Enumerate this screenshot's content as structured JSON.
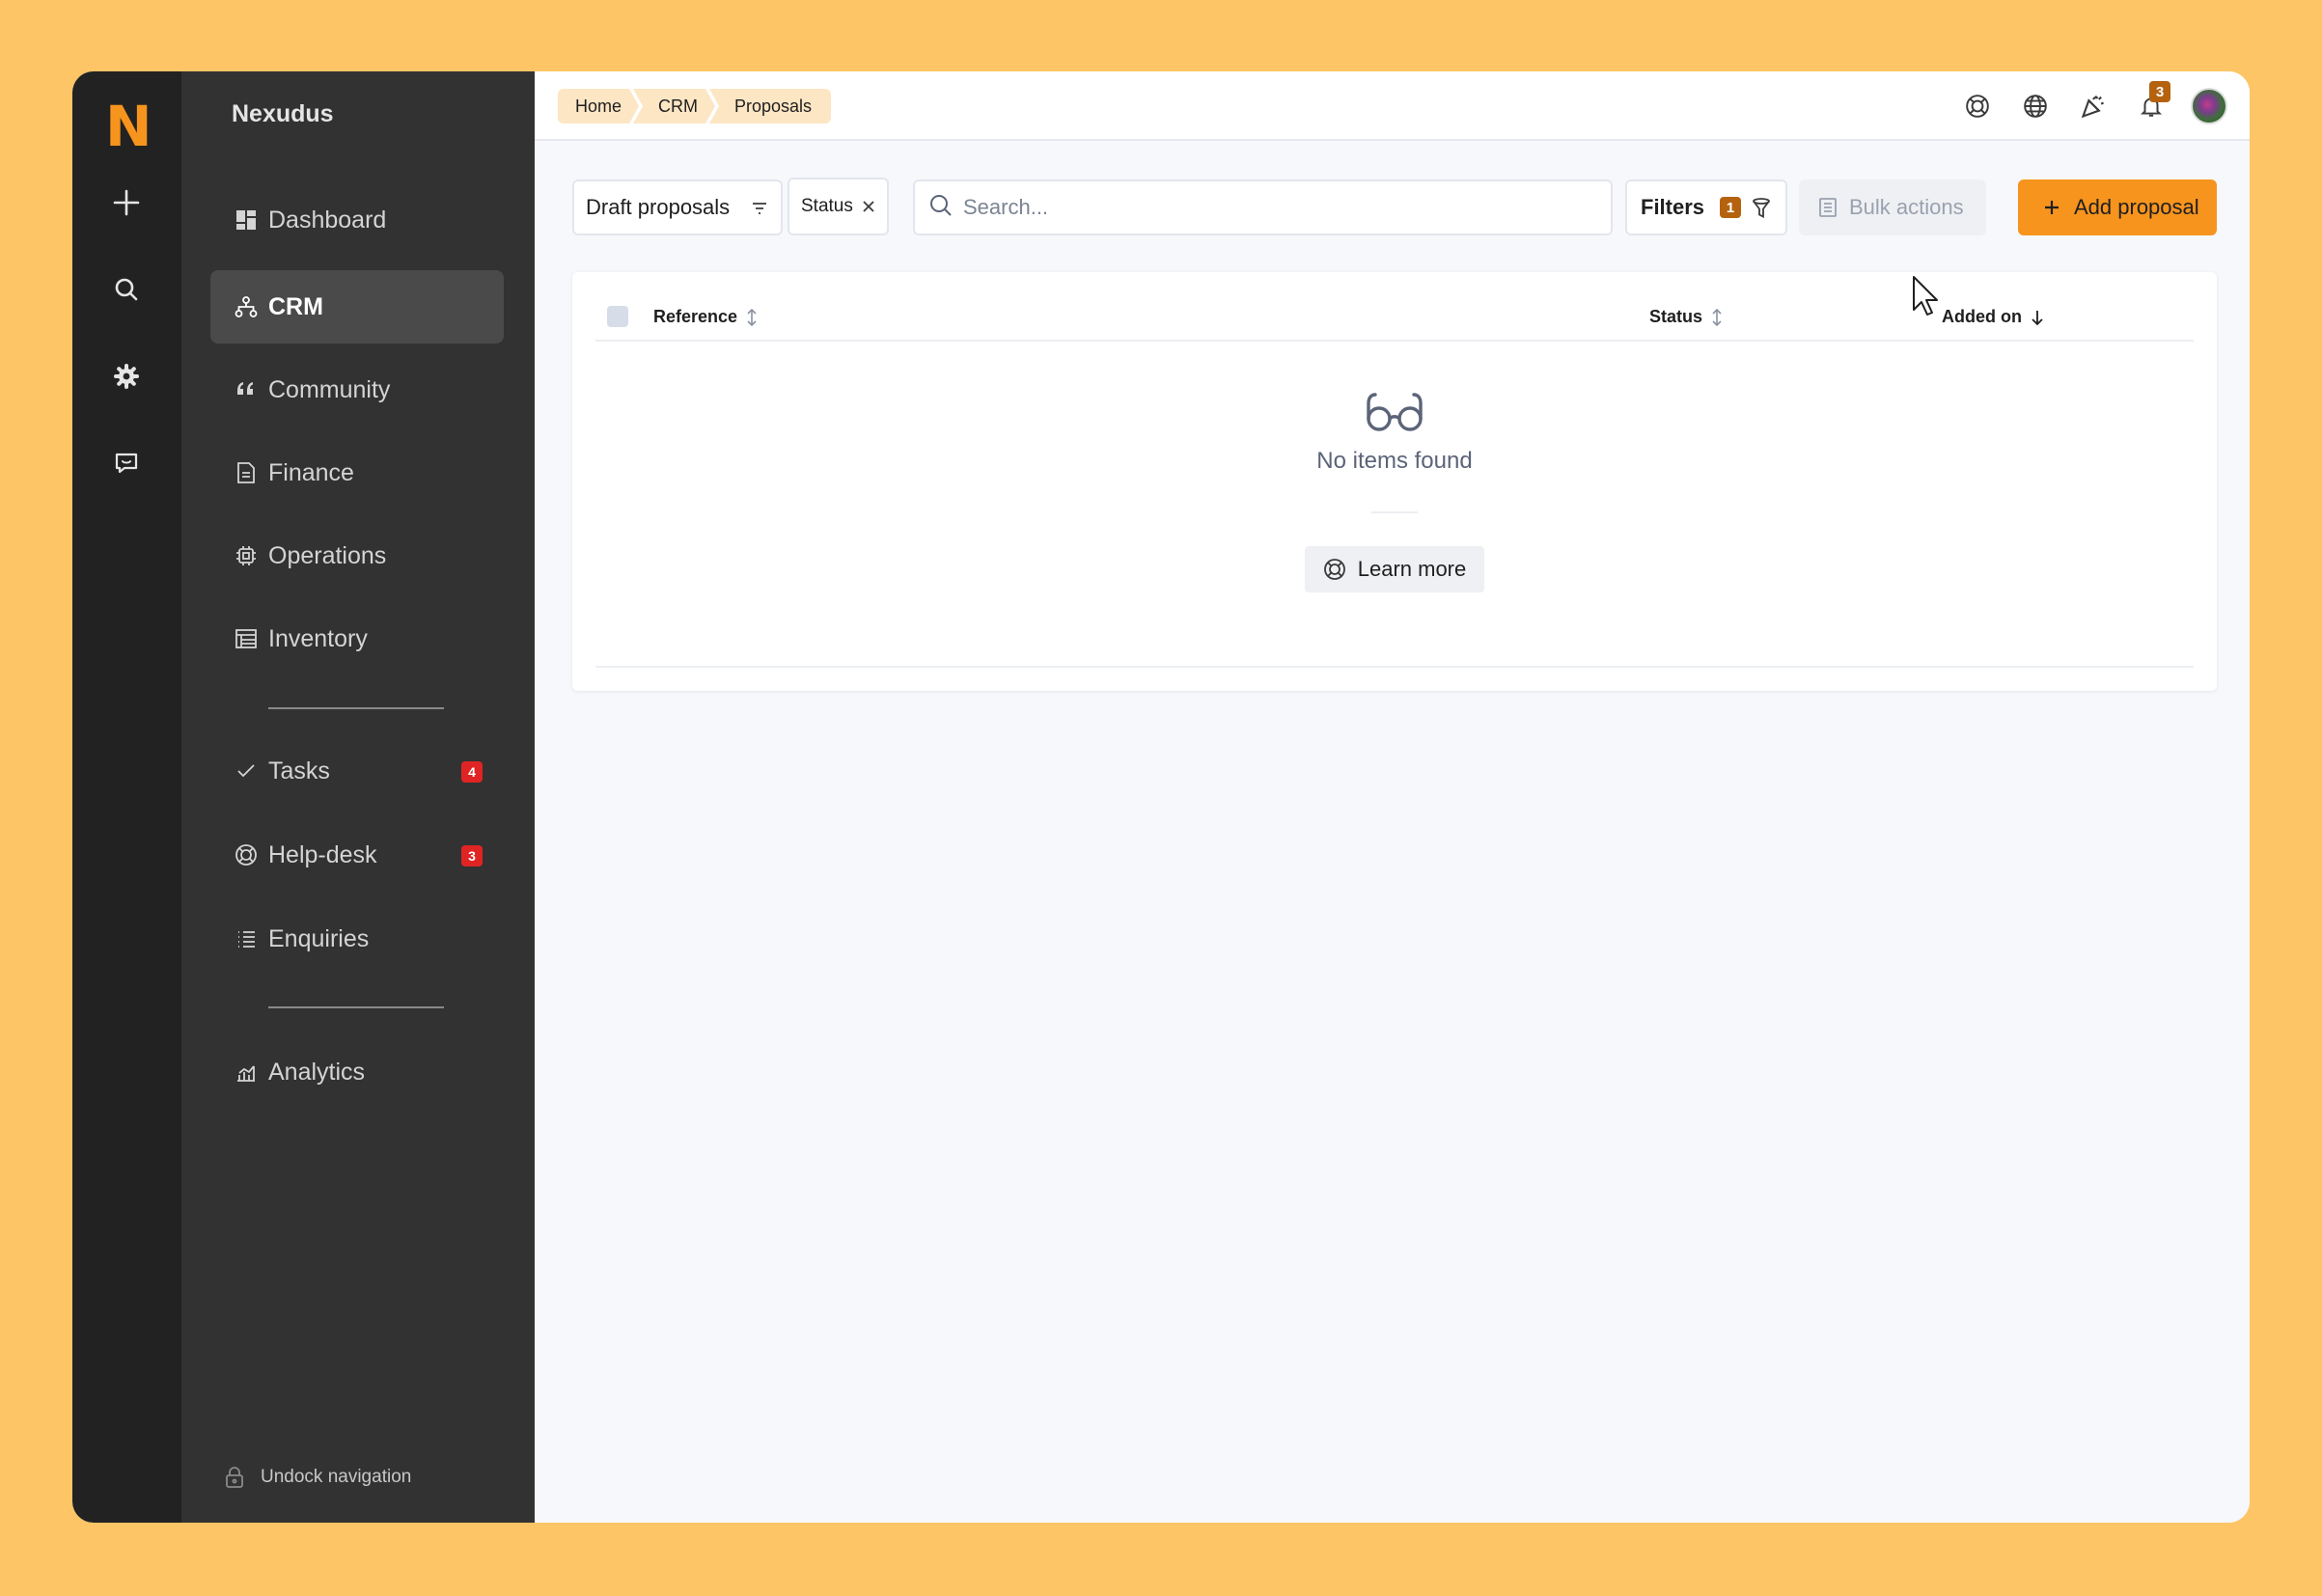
{
  "rail": {
    "logo": "N",
    "icons": [
      "plus-icon",
      "search-icon",
      "gear-icon",
      "chat-icon"
    ]
  },
  "sidebar": {
    "brand": "Nexudus",
    "items": [
      {
        "label": "Dashboard",
        "icon": "dashboard-icon"
      },
      {
        "label": "CRM",
        "icon": "crm-icon",
        "active": true
      },
      {
        "label": "Community",
        "icon": "quote-icon"
      },
      {
        "label": "Finance",
        "icon": "document-icon"
      },
      {
        "label": "Operations",
        "icon": "chip-icon"
      },
      {
        "label": "Inventory",
        "icon": "table-icon"
      },
      {
        "label": "Tasks",
        "icon": "check-icon",
        "badge": "4"
      },
      {
        "label": "Help-desk",
        "icon": "lifebuoy-icon",
        "badge": "3"
      },
      {
        "label": "Enquiries",
        "icon": "list-icon"
      },
      {
        "label": "Analytics",
        "icon": "chart-icon"
      }
    ],
    "undock_label": "Undock navigation"
  },
  "topbar": {
    "breadcrumbs": [
      "Home",
      "CRM",
      "Proposals"
    ],
    "notifications_count": "3"
  },
  "toolbar": {
    "view_label": "Draft proposals",
    "chip_label": "Status",
    "search_placeholder": "Search...",
    "filters_label": "Filters",
    "filters_count": "1",
    "bulk_label": "Bulk actions",
    "add_label": "Add proposal"
  },
  "table": {
    "columns": [
      "Reference",
      "Status",
      "Added on"
    ],
    "empty_message": "No items found",
    "learn_more_label": "Learn more"
  },
  "colors": {
    "accent": "#F7941D",
    "background": "#FDC566",
    "badge_red": "#E02424",
    "badge_brown": "#B5620F"
  }
}
